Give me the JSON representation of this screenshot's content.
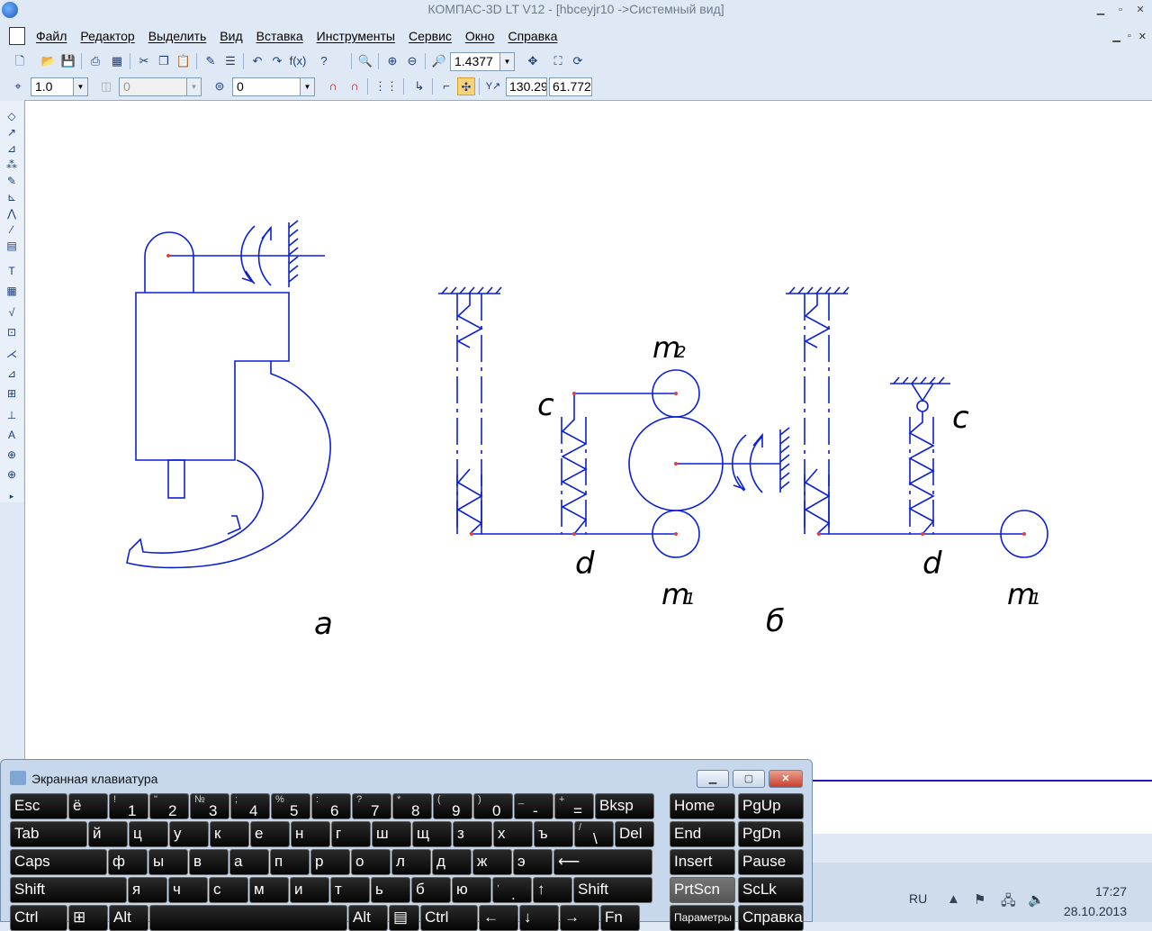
{
  "window": {
    "title": "КОМПАС-3D LT V12 - [hbceyjr10 ->Системный вид]",
    "controls": [
      "minimize",
      "maximize",
      "close"
    ]
  },
  "menu": {
    "items": [
      "Файл",
      "Редактор",
      "Выделить",
      "Вид",
      "Вставка",
      "Инструменты",
      "Сервис",
      "Окно",
      "Справка"
    ]
  },
  "toolbar1": {
    "zoom_value": "1.4377",
    "formula_label": "f(x)"
  },
  "toolbar2": {
    "step_value": "1.0",
    "layer_value": "0",
    "style_value": "0",
    "coord_x": "130.29",
    "coord_y": "61.772"
  },
  "drawing": {
    "labels": {
      "fig_a": "а",
      "fig_b": "б",
      "m2": "m",
      "m2_sub": "2",
      "m1_mid": "m",
      "m1_mid_sub": "1",
      "m1_right": "m",
      "m1_right_sub": "1",
      "c_left": "c",
      "c_right": "c",
      "d_left": "d",
      "d_right": "d"
    },
    "line_color": "#0a1fd6",
    "point_color": "#e04040"
  },
  "osk": {
    "title": "Экранная клавиатура",
    "rows": [
      [
        {
          "main": "Esc"
        },
        {
          "top": "",
          "main": "ё"
        },
        {
          "top": "!",
          "bot": "1"
        },
        {
          "top": "\"",
          "bot": "2"
        },
        {
          "top": "№",
          "bot": "3"
        },
        {
          "top": ";",
          "bot": "4"
        },
        {
          "top": "%",
          "bot": "5"
        },
        {
          "top": ":",
          "bot": "6"
        },
        {
          "top": "?",
          "bot": "7"
        },
        {
          "top": "*",
          "bot": "8"
        },
        {
          "top": "(",
          "bot": "9"
        },
        {
          "top": ")",
          "bot": "0"
        },
        {
          "top": "_",
          "bot": "-"
        },
        {
          "top": "+",
          "bot": "="
        },
        {
          "main": "Bksp"
        }
      ],
      [
        {
          "main": "Tab"
        },
        {
          "main": "й"
        },
        {
          "main": "ц"
        },
        {
          "main": "у"
        },
        {
          "main": "к"
        },
        {
          "main": "е"
        },
        {
          "main": "н"
        },
        {
          "main": "г"
        },
        {
          "main": "ш"
        },
        {
          "main": "щ"
        },
        {
          "main": "з"
        },
        {
          "main": "х"
        },
        {
          "main": "ъ"
        },
        {
          "top": "/",
          "bot": "\\"
        },
        {
          "main": "Del"
        }
      ],
      [
        {
          "main": "Caps"
        },
        {
          "main": "ф"
        },
        {
          "main": "ы"
        },
        {
          "main": "в"
        },
        {
          "main": "а"
        },
        {
          "main": "п"
        },
        {
          "main": "р"
        },
        {
          "main": "о"
        },
        {
          "main": "л"
        },
        {
          "main": "д"
        },
        {
          "main": "ж"
        },
        {
          "main": "э"
        },
        {
          "main": "⟵"
        }
      ],
      [
        {
          "main": "Shift"
        },
        {
          "main": "я"
        },
        {
          "main": "ч"
        },
        {
          "main": "с"
        },
        {
          "main": "м"
        },
        {
          "main": "и"
        },
        {
          "main": "т"
        },
        {
          "main": "ь"
        },
        {
          "main": "б"
        },
        {
          "main": "ю"
        },
        {
          "top": ",",
          "bot": "."
        },
        {
          "main": "↑"
        },
        {
          "main": "Shift"
        }
      ],
      [
        {
          "main": "Ctrl"
        },
        {
          "main": "⊞"
        },
        {
          "main": "Alt"
        },
        {
          "main": ""
        },
        {
          "main": "Alt"
        },
        {
          "main": "▤"
        },
        {
          "main": "Ctrl"
        },
        {
          "main": "←"
        },
        {
          "main": "↓"
        },
        {
          "main": "→"
        },
        {
          "main": "Fn"
        }
      ]
    ],
    "side_keys": [
      [
        "Home",
        "PgUp"
      ],
      [
        "End",
        "PgDn"
      ],
      [
        "Insert",
        "Pause"
      ],
      [
        "PrtScn",
        "ScLk"
      ],
      [
        "Параметры",
        "Справка"
      ]
    ]
  },
  "tray": {
    "language": "RU",
    "time": "17:27",
    "date": "28.10.2013"
  }
}
